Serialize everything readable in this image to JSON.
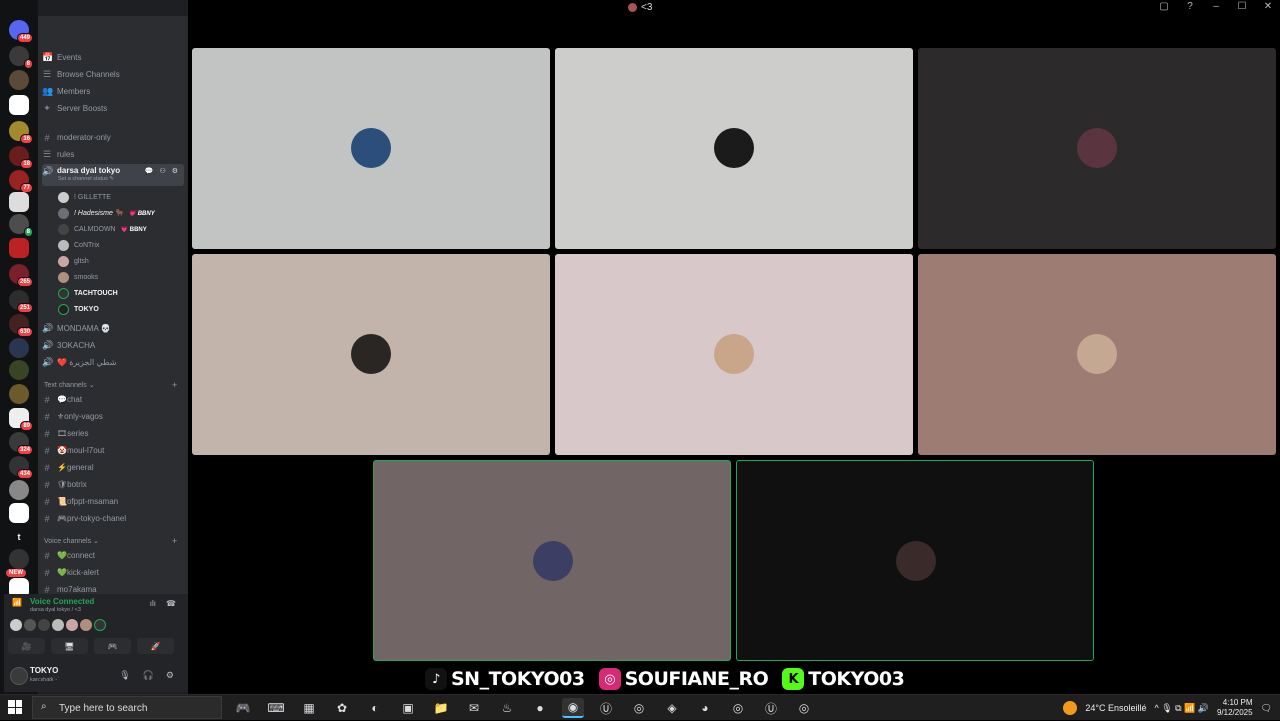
{
  "window": {
    "title": "<3",
    "controls": [
      "▢",
      "?",
      "–",
      "☐",
      "✕"
    ]
  },
  "server": {
    "name": "<3"
  },
  "rail": {
    "badges": [
      "449",
      "8",
      "16",
      "18",
      "77",
      "8",
      "265",
      "251",
      "630",
      "89",
      "324",
      "434"
    ],
    "new_label": "NEW",
    "t_label": "t"
  },
  "nav": [
    {
      "icon": "📅",
      "label": "Events"
    },
    {
      "icon": "☰",
      "label": "Browse Channels"
    },
    {
      "icon": "👥",
      "label": "Members"
    },
    {
      "icon": "✦",
      "label": "Server Boosts"
    }
  ],
  "channels_top": [
    {
      "icon": "#",
      "label": "moderator-only"
    },
    {
      "icon": "☰",
      "label": "rules"
    }
  ],
  "active_voice": {
    "label": "darsa dyal tokyo",
    "status": "Set a channel status ✎",
    "actions": "💬 ⚇ ⚙"
  },
  "voice_users": [
    {
      "name": "! GILLETTE",
      "tag": ""
    },
    {
      "name": "! Hadesisme 🐂",
      "tag": "💗 BBNY"
    },
    {
      "name": "CALMDOWN",
      "tag": "💗 BBNY"
    },
    {
      "name": "CoNTrix",
      "tag": ""
    },
    {
      "name": "gltsh",
      "tag": ""
    },
    {
      "name": "smooks",
      "tag": ""
    },
    {
      "name": "TACHTOUCH",
      "tag": ""
    },
    {
      "name": "TOKYO",
      "tag": ""
    }
  ],
  "voice_other": [
    {
      "icon": "🔊",
      "label": "MONDAMA 💀"
    },
    {
      "icon": "🔊",
      "label": "3OKACHA"
    },
    {
      "icon": "🔊",
      "label": "❤️ شطي الجزيرة"
    }
  ],
  "text_category": {
    "label": "Text channels ⌄",
    "plus": "+"
  },
  "text_channels": [
    {
      "icon": "#",
      "label": "💬chat"
    },
    {
      "icon": "#",
      "label": "⚜only-vagos"
    },
    {
      "icon": "#",
      "label": "🎞series"
    },
    {
      "icon": "#",
      "label": "🤡moul-l7out"
    },
    {
      "icon": "#",
      "label": "⚡general"
    },
    {
      "icon": "#",
      "label": "🛡botrix"
    },
    {
      "icon": "#",
      "label": "📜ofppt-msaman"
    },
    {
      "icon": "#",
      "label": "🎮prv-tokyo-chanel"
    }
  ],
  "voice_category": {
    "label": "Voice channels ⌄",
    "plus": "+"
  },
  "voice_channels": [
    {
      "icon": "#",
      "label": "💚connect"
    },
    {
      "icon": "#",
      "label": "💚kick-alert"
    },
    {
      "icon": "#",
      "label": "mo7akama"
    }
  ],
  "voice_panel": {
    "title": "Voice Connected",
    "subtitle": "darsa dyal tokyo / <3",
    "buttons": [
      "🎥",
      "🖥",
      "🎮",
      "🚀"
    ]
  },
  "user_panel": {
    "name": "TOKYO",
    "status": "kan:shatk`-`",
    "controls": [
      "🎙",
      "🎧",
      "⚙"
    ]
  },
  "tiles": [
    {
      "bg": "#c1c4c3",
      "avatar": "#2b4f7a",
      "speaking": false
    },
    {
      "bg": "#cdcdcb",
      "avatar": "#1b1b1b",
      "speaking": false
    },
    {
      "bg": "#2c2a2b",
      "avatar": "#5a3540",
      "speaking": false
    },
    {
      "bg": "#c2b4ab",
      "avatar": "#2a2624",
      "speaking": false
    },
    {
      "bg": "#d9c8ca",
      "avatar": "#c9a58a",
      "speaking": false
    },
    {
      "bg": "#9d7c73",
      "avatar": "#c4a892",
      "speaking": false
    },
    {
      "bg": "#716565",
      "avatar": "#3d3e63",
      "speaking": true
    },
    {
      "bg": "#101010",
      "avatar": "#3a2a2a",
      "speaking": true
    }
  ],
  "social": [
    {
      "icon": "♪",
      "color": "#111111",
      "handle": "SN_TOKYO03"
    },
    {
      "icon": "◎",
      "color": "#d62976",
      "handle": "SOUFIANE_RO"
    },
    {
      "icon": "K",
      "color": "#53fc18",
      "handle": "TOKYO03"
    }
  ],
  "taskbar": {
    "search_placeholder": "Type here to search",
    "apps": [
      "🎮",
      "⌨",
      "▦",
      "✿",
      "◐",
      "▣",
      "📁",
      "✉",
      "♨",
      "●",
      "◉",
      "Ⓤ",
      "◎",
      "◈",
      "◕",
      "◎",
      "Ⓤ",
      "◎"
    ],
    "weather": "24°C  Ensoleillé",
    "tray": "^ 🎙 ⧉ 📶 🔊",
    "time": "4:10 PM",
    "date": "9/12/2025",
    "notif": "🗨"
  }
}
